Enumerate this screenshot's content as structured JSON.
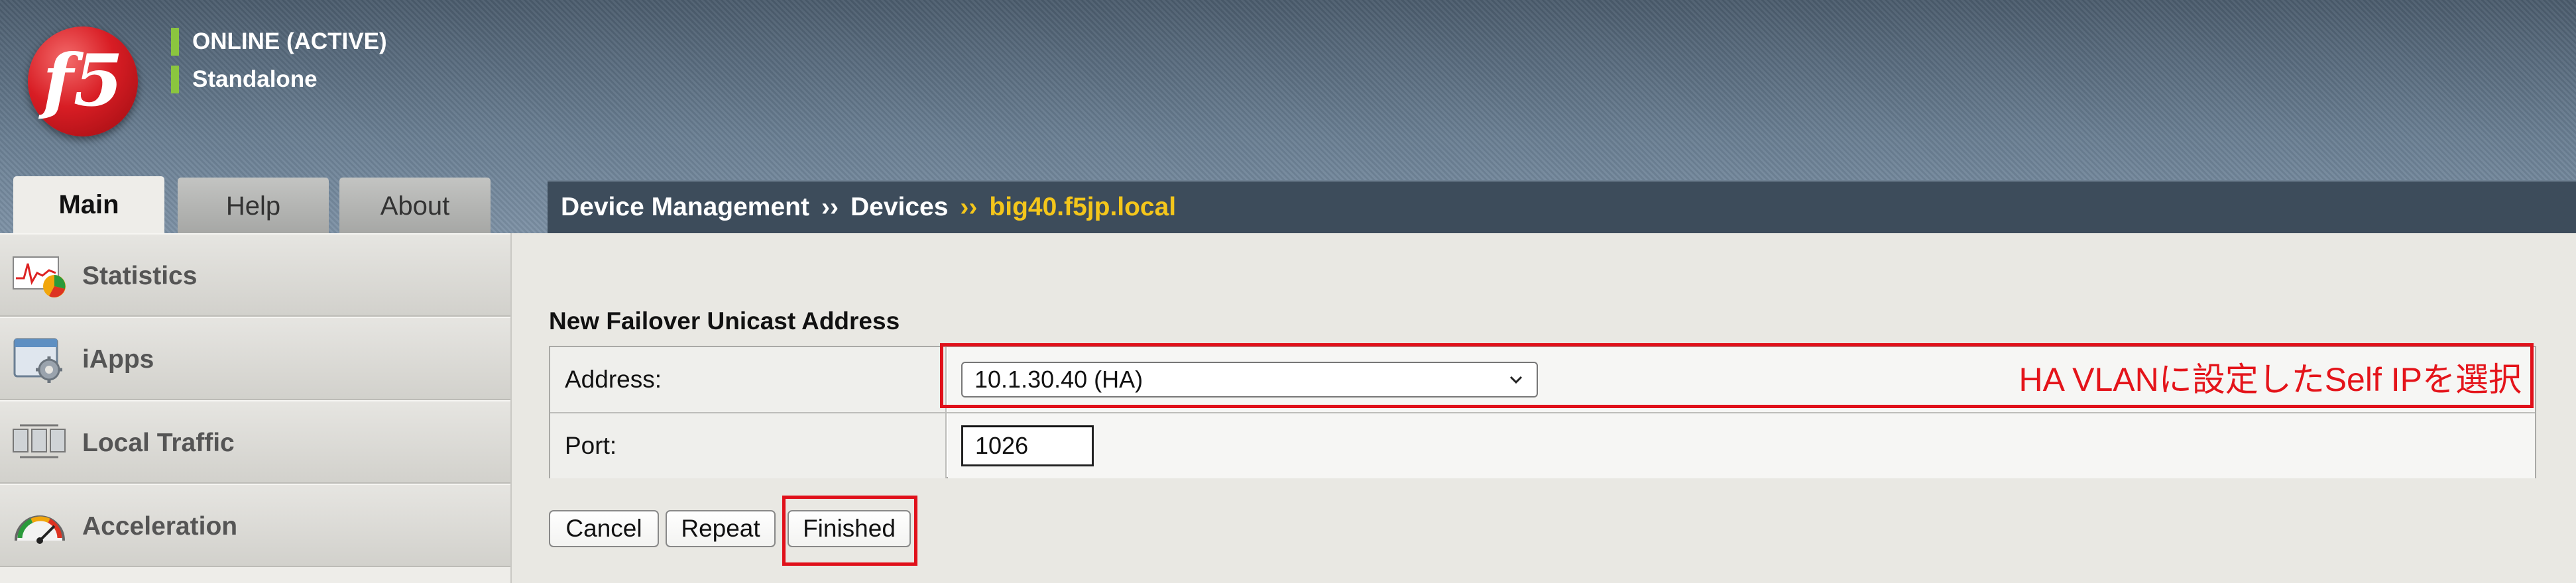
{
  "header": {
    "status_line1": "ONLINE (ACTIVE)",
    "status_line2": "Standalone",
    "logo_text": "f5",
    "status_color": "#8bc53f",
    "logo_color": "#d81d24"
  },
  "tabs": [
    {
      "label": "Main",
      "active": true
    },
    {
      "label": "Help",
      "active": false
    },
    {
      "label": "About",
      "active": false
    }
  ],
  "breadcrumb": {
    "items": [
      "Device Management",
      "Devices",
      "big40.f5jp.local"
    ],
    "separator": "››",
    "current_color": "#f4c61b"
  },
  "sidebar": {
    "items": [
      {
        "label": "Statistics",
        "icon": "statistics-chart-icon"
      },
      {
        "label": "iApps",
        "icon": "iapps-gear-icon"
      },
      {
        "label": "Local Traffic",
        "icon": "local-traffic-icon"
      },
      {
        "label": "Acceleration",
        "icon": "acceleration-gauge-icon"
      }
    ]
  },
  "form": {
    "section_title": "New Failover Unicast Address",
    "address_label": "Address:",
    "address_value": "10.1.30.40 (HA)",
    "port_label": "Port:",
    "port_value": "1026"
  },
  "annotation": {
    "text": "HA VLANに設定したSelf IPを選択",
    "color": "#e4141a"
  },
  "buttons": {
    "cancel": "Cancel",
    "repeat": "Repeat",
    "finished": "Finished"
  }
}
